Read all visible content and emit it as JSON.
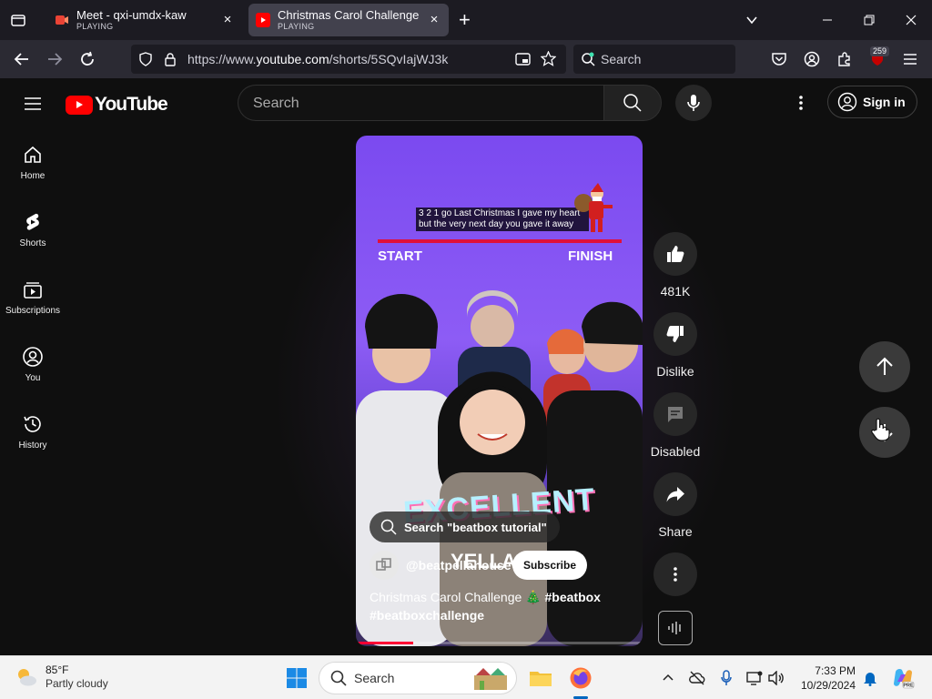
{
  "browser": {
    "tabs": [
      {
        "title": "Meet - qxi-umdx-kaw",
        "status": "PLAYING",
        "close": "×"
      },
      {
        "title": "Christmas Carol Challenge 🎄 #",
        "status": "PLAYING",
        "close": "×"
      }
    ],
    "new_tab": "+",
    "url_prefix": "https://www.",
    "url_domain": "youtube.com",
    "url_path": "/shorts/5SQvIajWJ3k",
    "search_placeholder": "Search",
    "extension_badge": "259"
  },
  "youtube": {
    "logo_text": "YouTube",
    "search_placeholder": "Search",
    "sign_in": "Sign in",
    "sidebar": [
      {
        "label": "Home",
        "icon": "home-icon"
      },
      {
        "label": "Shorts",
        "icon": "shorts-icon"
      },
      {
        "label": "Subscriptions",
        "icon": "subscriptions-icon"
      },
      {
        "label": "You",
        "icon": "you-icon"
      },
      {
        "label": "History",
        "icon": "history-icon"
      }
    ]
  },
  "short": {
    "lyrics": "3 2 1 go Last Christmas I gave my heart but the very next day you gave it away",
    "start_label": "START",
    "finish_label": "FINISH",
    "overlay_word": "EXCELLENT",
    "overlay_word2": "YELLA",
    "search_suggestion": "Search \"beatbox tutorial\"",
    "channel": "@beatpellahouse",
    "subscribe": "Subscribe",
    "title_text": "Christmas Carol Challenge 🎄 ",
    "title_tag1": "#beatbox",
    "title_tag2": "#beatboxchallenge",
    "progress_fraction": 0.2,
    "actions": {
      "likes": "481K",
      "dislike": "Dislike",
      "comments": "Disabled",
      "share": "Share"
    }
  },
  "taskbar": {
    "temp": "85°F",
    "condition": "Partly cloudy",
    "search": "Search",
    "time": "7:33 PM",
    "date": "10/29/2024"
  },
  "colors": {
    "yt_red": "#ff0000",
    "video_purple": "#8d5cf5",
    "progress_red": "#ff0033"
  }
}
